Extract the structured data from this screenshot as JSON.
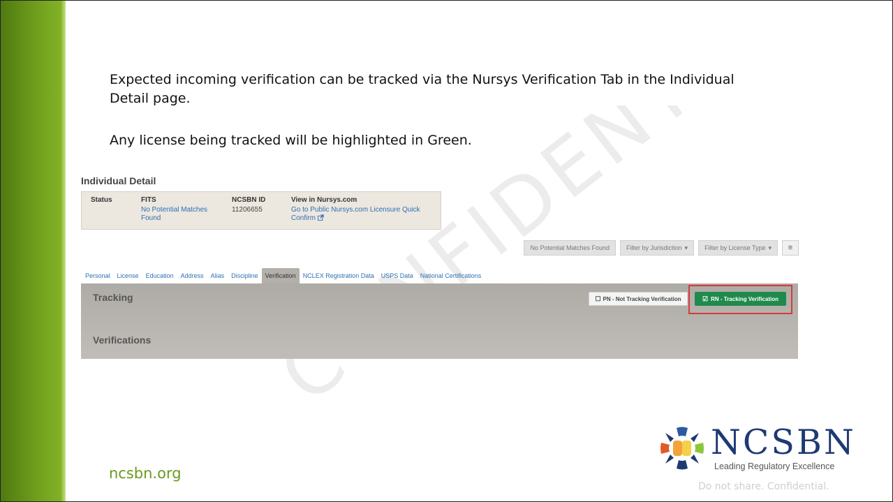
{
  "slide": {
    "intro_line1": "Expected incoming verification can be tracked via the Nursys Verification Tab in the Individual Detail page.",
    "intro_line2": "Any license being tracked will be highlighted in Green.",
    "watermark_text": "CONFIDENTIAL",
    "footer_link": "ncsbn.org",
    "confidential_note": "Do not share. Confidential.",
    "accent_green": "#6a9a1f"
  },
  "logo": {
    "wordmark": "NCSBN",
    "tagline": "Leading Regulatory Excellence"
  },
  "app": {
    "page_title": "Individual Detail",
    "summary": {
      "status_header": "Status",
      "fits_header": "FITS",
      "fits_value_1": "No Potential Matches",
      "fits_value_2": "Found",
      "ncsbn_id_header": "NCSBN ID",
      "ncsbn_id_value": "11206655",
      "nursys_header": "View in Nursys.com",
      "nursys_link_1": "Go to Public Nursys.com Licensure Quick",
      "nursys_link_2": "Confirm"
    },
    "buttons": {
      "no_matches": "No Potential Matches Found",
      "filter_jurisdiction": "Filter by Jurisdiction",
      "filter_license_type": "Filter by License Type",
      "menu_icon": "≡"
    },
    "tabs": [
      {
        "label": "Personal"
      },
      {
        "label": "License"
      },
      {
        "label": "Education"
      },
      {
        "label": "Address"
      },
      {
        "label": "Alias"
      },
      {
        "label": "Discipline"
      },
      {
        "label": "Verification",
        "active": true
      },
      {
        "label": "NCLEX Registration Data"
      },
      {
        "label": "USPS Data"
      },
      {
        "label": "National Certifications"
      }
    ],
    "panel": {
      "tracking_label": "Tracking",
      "verifications_label": "Verifications",
      "pn_button": "PN - Not Tracking Verification",
      "rn_button": "RN - Tracking Verification",
      "tracking_color": "#1f8a4c",
      "highlight_color": "#d63b3b"
    }
  }
}
